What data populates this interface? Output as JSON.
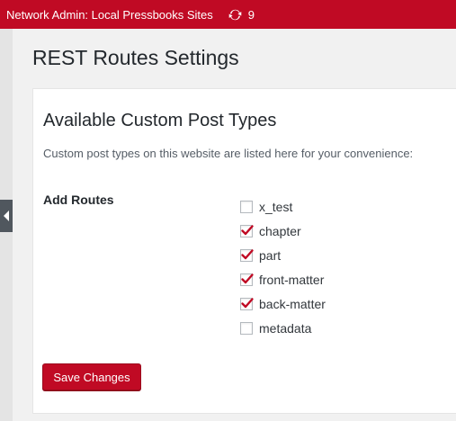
{
  "admin_bar": {
    "site_name": "Network Admin: Local Pressbooks Sites",
    "updates_icon": "refresh-icon",
    "updates_count": "9"
  },
  "page": {
    "title": "REST Routes Settings"
  },
  "settings": {
    "section_title": "Available Custom Post Types",
    "description": "Custom post types on this website are listed here for your convenience:",
    "field_label": "Add Routes",
    "routes": [
      {
        "label": "x_test",
        "checked": false
      },
      {
        "label": "chapter",
        "checked": true
      },
      {
        "label": "part",
        "checked": true
      },
      {
        "label": "front-matter",
        "checked": true
      },
      {
        "label": "back-matter",
        "checked": true
      },
      {
        "label": "metadata",
        "checked": false
      }
    ],
    "save_label": "Save Changes"
  },
  "colors": {
    "brand": "#c00a24",
    "check": "#c00a24"
  }
}
